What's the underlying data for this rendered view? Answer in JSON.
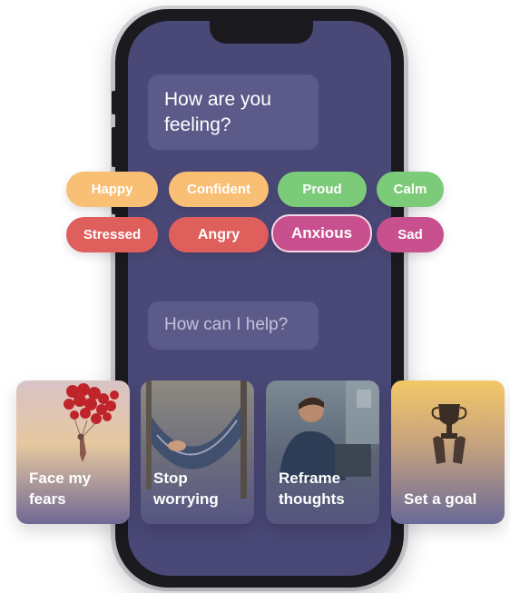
{
  "chat": {
    "prompt_feeling": "How are you feeling?",
    "prompt_help": "How can I help?"
  },
  "moods": {
    "happy": "Happy",
    "confident": "Confident",
    "proud": "Proud",
    "calm": "Calm",
    "stressed": "Stressed",
    "angry": "Angry",
    "anxious": "Anxious",
    "sad": "Sad"
  },
  "selected_mood": "Anxious",
  "help_cards": [
    {
      "label": "Face my fears"
    },
    {
      "label": "Stop worrying"
    },
    {
      "label": "Reframe thoughts"
    },
    {
      "label": "Set a goal"
    }
  ],
  "colors": {
    "screen": "#4a4877",
    "bubble": "#5c5a89",
    "chip_yellow": "#f9bf74",
    "chip_green": "#7ccb78",
    "chip_red": "#df5f5c",
    "chip_pink": "#c8508e"
  }
}
